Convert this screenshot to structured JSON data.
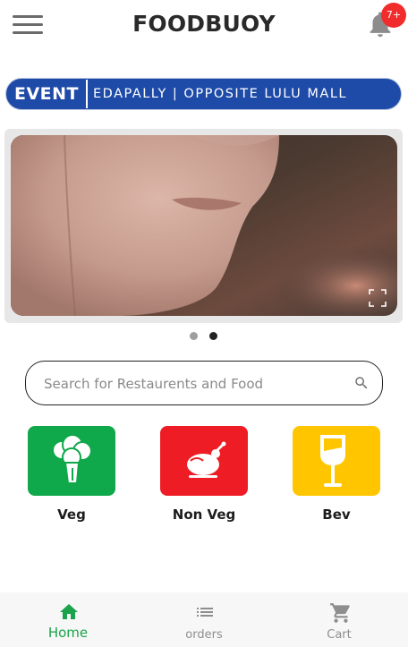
{
  "app_bar": {
    "title": "FOODBUOY",
    "menu_icon": "hamburger-menu-icon",
    "notification_icon": "bell-icon",
    "notification_count": "7+"
  },
  "ticker": {
    "label": "EVENT",
    "text": "EDAPALLY | OPPOSITE LULU MALL",
    "color": "#1e4aa8"
  },
  "carousel": {
    "image": "close-up photo of a person's chin and lips",
    "fullscreen_icon": "fullscreen-icon",
    "dots": 2,
    "active_index": 1
  },
  "search": {
    "placeholder": "Search for Restaurents and Food",
    "icon": "search-icon"
  },
  "categories": [
    {
      "label": "Veg",
      "icon": "broccoli-icon",
      "color": "#0fa84a"
    },
    {
      "label": "Non Veg",
      "icon": "chicken-icon",
      "color": "#ee1c24"
    },
    {
      "label": "Bev",
      "icon": "glass-icon",
      "color": "#ffc600"
    }
  ],
  "bottom_nav": {
    "active_color": "#1aa34a",
    "inactive_color": "#8e8e8e",
    "items": [
      {
        "label": "Home",
        "icon": "home-icon",
        "active": true
      },
      {
        "label": "orders",
        "icon": "list-icon",
        "active": false
      },
      {
        "label": "Cart",
        "icon": "cart-icon",
        "active": false
      }
    ]
  }
}
